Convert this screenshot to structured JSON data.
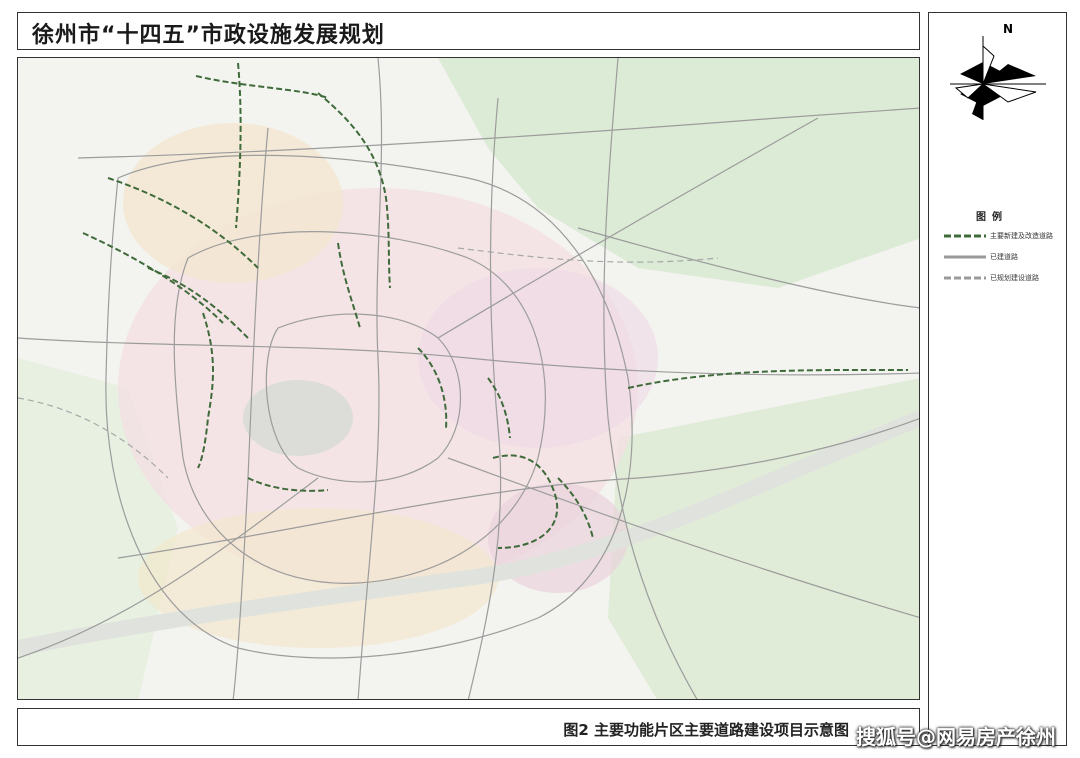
{
  "header": {
    "title": "徐州市“十四五”市政设施发展规划"
  },
  "compass": {
    "label": "N"
  },
  "legend": {
    "title": "图例",
    "items": [
      {
        "label": "主要新建及改造道路",
        "style": "dashed",
        "color": "#3f6b3a"
      },
      {
        "label": "已建道路",
        "style": "solid",
        "color": "#9a9a9a"
      },
      {
        "label": "已规划建设道路",
        "style": "dashed",
        "color": "#9a9a9a"
      }
    ]
  },
  "caption": {
    "text": "图2  主要功能片区主要道路建设项目示意图"
  },
  "watermark": {
    "text": "搜狐号@网易房产徐州"
  },
  "colors": {
    "new_road": "#3f6b3a",
    "built_road": "#9a9a9a",
    "green_area": "#d7e8cf",
    "urban_pink": "#f2d3da",
    "urban_yellow": "#f3e9c6",
    "water": "#e6e6e6"
  }
}
